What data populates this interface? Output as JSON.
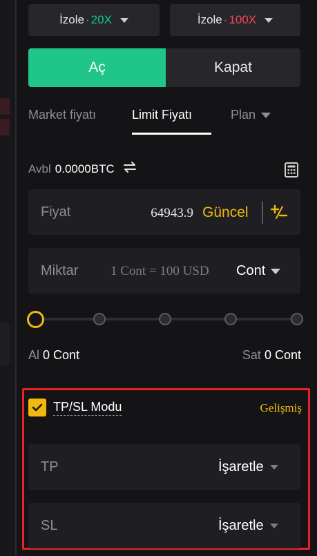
{
  "leverage": {
    "long": {
      "mode": "İzole",
      "sep": "·",
      "value": "20X"
    },
    "short": {
      "mode": "İzole",
      "sep": "·",
      "value": "100X"
    }
  },
  "side": {
    "open_label": "Aç",
    "close_label": "Kapat"
  },
  "order_tabs": {
    "market": "Market fiyatı",
    "limit": "Limit Fiyatı",
    "plan": "Plan",
    "active": "limit"
  },
  "available": {
    "label": "Avbl",
    "value": "0.0000BTC"
  },
  "price": {
    "label": "Fiyat",
    "value": "64943.9",
    "latest_button": "Güncel"
  },
  "quantity": {
    "label": "Miktar",
    "hint": "1 Cont = 100 USD",
    "unit": "Cont"
  },
  "slider": {
    "percent": 0
  },
  "buy": {
    "label": "Al",
    "value": "0 Cont"
  },
  "sell": {
    "label": "Sat",
    "value": "0 Cont"
  },
  "tpsl": {
    "checked": true,
    "mode_label": "TP/SL Modu",
    "advanced_label": "Gelişmiş",
    "tp_label": "TP",
    "sl_label": "SL",
    "tp_value": "İşaretle",
    "sl_value": "İşaretle"
  },
  "colors": {
    "accent": "#f0b90b",
    "buy": "#20c58a",
    "long": "#0ecb81",
    "short": "#f6465d",
    "highlight_border": "#e8202a"
  },
  "icons": [
    "swap-icon",
    "calculator-icon",
    "plus-minus-icon",
    "check-icon",
    "chevron-down-icon"
  ]
}
